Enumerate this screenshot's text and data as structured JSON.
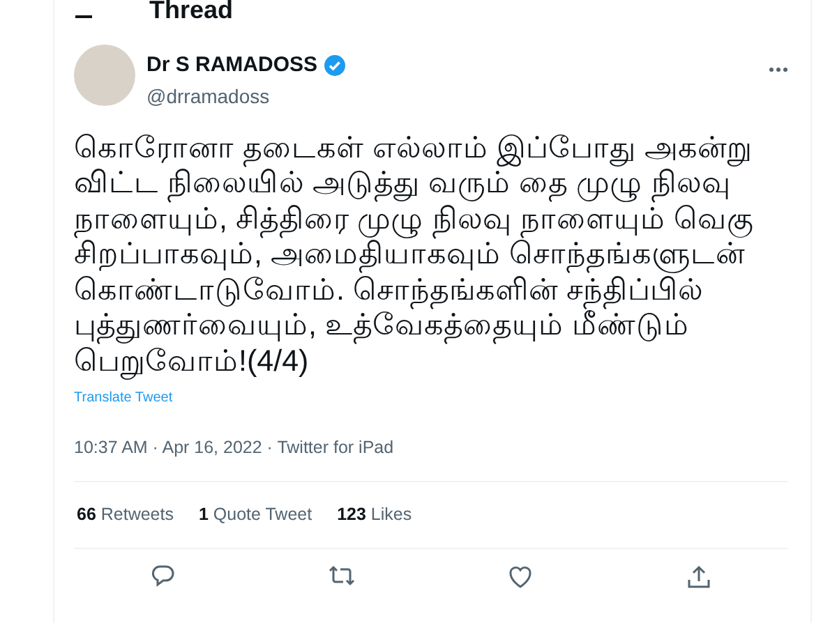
{
  "header": {
    "title": "Thread"
  },
  "tweet": {
    "author": {
      "name": "Dr S RAMADOSS",
      "verified": true,
      "handle": "@drramadoss"
    },
    "text": "கொரோனா தடைகள் எல்லாம் இப்போது அகன்று விட்ட நிலையில் அடுத்து வரும் தை முழு நிலவு நாளையும், சித்திரை முழு நிலவு நாளையும் வெகு சிறப்பாகவும், அமைதியாகவும் சொந்தங்களுடன் கொண்டாடுவோம். சொந்தங்களின் சந்திப்பில் புத்துணர்வையும், உத்வேகத்தையும் மீண்டும் பெறுவோம்!(4/4)",
    "translate": "Translate Tweet",
    "meta": "10:37 AM · Apr 16, 2022 · Twitter for iPad",
    "stats": [
      {
        "count": "66",
        "label": "Retweets"
      },
      {
        "count": "1",
        "label": "Quote Tweet"
      },
      {
        "count": "123",
        "label": "Likes"
      }
    ],
    "actions": [
      {
        "kind": "reply"
      },
      {
        "kind": "retweet"
      },
      {
        "kind": "like"
      },
      {
        "kind": "share"
      }
    ]
  }
}
